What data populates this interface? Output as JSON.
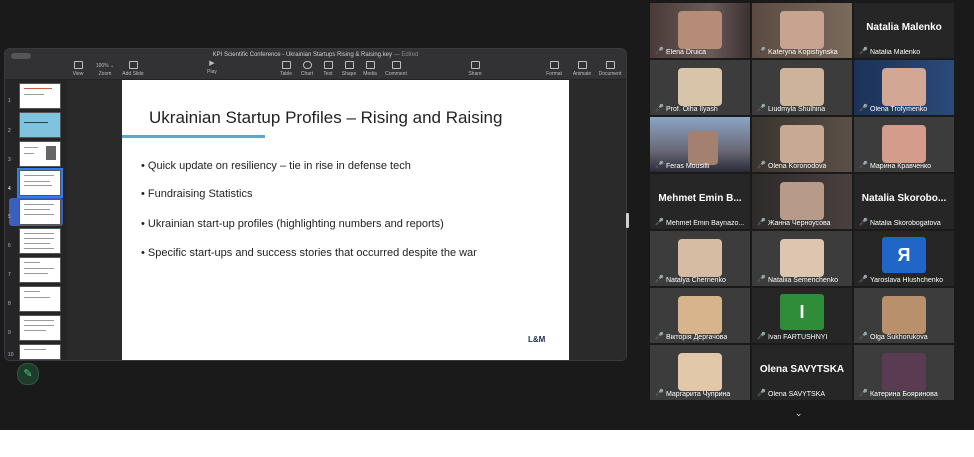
{
  "keynote": {
    "title": "KPI Scientific Conference - Ukrainian Startups Rising & Raising.key",
    "title_status": "— Edited",
    "toolbar": {
      "view": "View",
      "zoom_value": "100% ⌄",
      "zoom_label": "Zoom",
      "add_slide": "Add Slide",
      "play": "Play",
      "table": "Table",
      "chart": "Chart",
      "text": "Text",
      "shape": "Shape",
      "media": "Media",
      "comment": "Comment",
      "share": "Share",
      "format": "Format",
      "animate": "Animate",
      "document": "Document"
    },
    "slide_numbers": [
      "1",
      "2",
      "3",
      "4",
      "5",
      "6",
      "7",
      "8",
      "9",
      "10"
    ],
    "slide": {
      "title": "Ukrainian Startup Profiles – Rising and Raising",
      "bullets": [
        "• Quick update on resiliency – tie in rise in defense tech",
        "• Fundraising Statistics",
        "• Ukrainian start-up profiles (highlighting numbers and reports)",
        "• Specific start-ups and success stories that occurred despite the war"
      ],
      "logo": "L&M"
    }
  },
  "gallery": {
    "participants": [
      {
        "name": "Elena Druica",
        "big": ""
      },
      {
        "name": "Kateryna Kopishynska",
        "big": ""
      },
      {
        "name": "Natalia Malenko",
        "big": "Natalia Malenko"
      },
      {
        "name": "Prof. Olha Ilyash",
        "big": ""
      },
      {
        "name": "Liudmyla Shulhina",
        "big": ""
      },
      {
        "name": "Olena Trofymenko",
        "big": ""
      },
      {
        "name": "Feras Mousilli",
        "big": ""
      },
      {
        "name": "Olena Koronodova",
        "big": ""
      },
      {
        "name": "Марина Кравченко",
        "big": ""
      },
      {
        "name": "Mehmet Emin Baynazo...",
        "big": "Mehmet Emin B..."
      },
      {
        "name": "Жанна Черноусова",
        "big": ""
      },
      {
        "name": "Natalia Skorobogatova",
        "big": "Natalia Skorobo..."
      },
      {
        "name": "Natalya Chernenko",
        "big": ""
      },
      {
        "name": "Nataliia Semenchenko",
        "big": ""
      },
      {
        "name": "Yaroslava Hlushchenko",
        "big": "",
        "letter": "Я"
      },
      {
        "name": "Вікторія Дергачова",
        "big": ""
      },
      {
        "name": "Ivan FARTUSHNYI",
        "big": "",
        "letter": "I"
      },
      {
        "name": "Olga Sukhorukova",
        "big": ""
      },
      {
        "name": "Маргарита Чуприна",
        "big": ""
      },
      {
        "name": "Olena SAVYTSKA",
        "big": "Olena SAVYTSKA"
      },
      {
        "name": "Катерина Бояринова",
        "big": ""
      }
    ],
    "more": "⌄"
  },
  "colors": {
    "active_speaker": "#3fcf6b",
    "muted_mic": "#e04646",
    "slide_accent": "#5ea7c9"
  }
}
